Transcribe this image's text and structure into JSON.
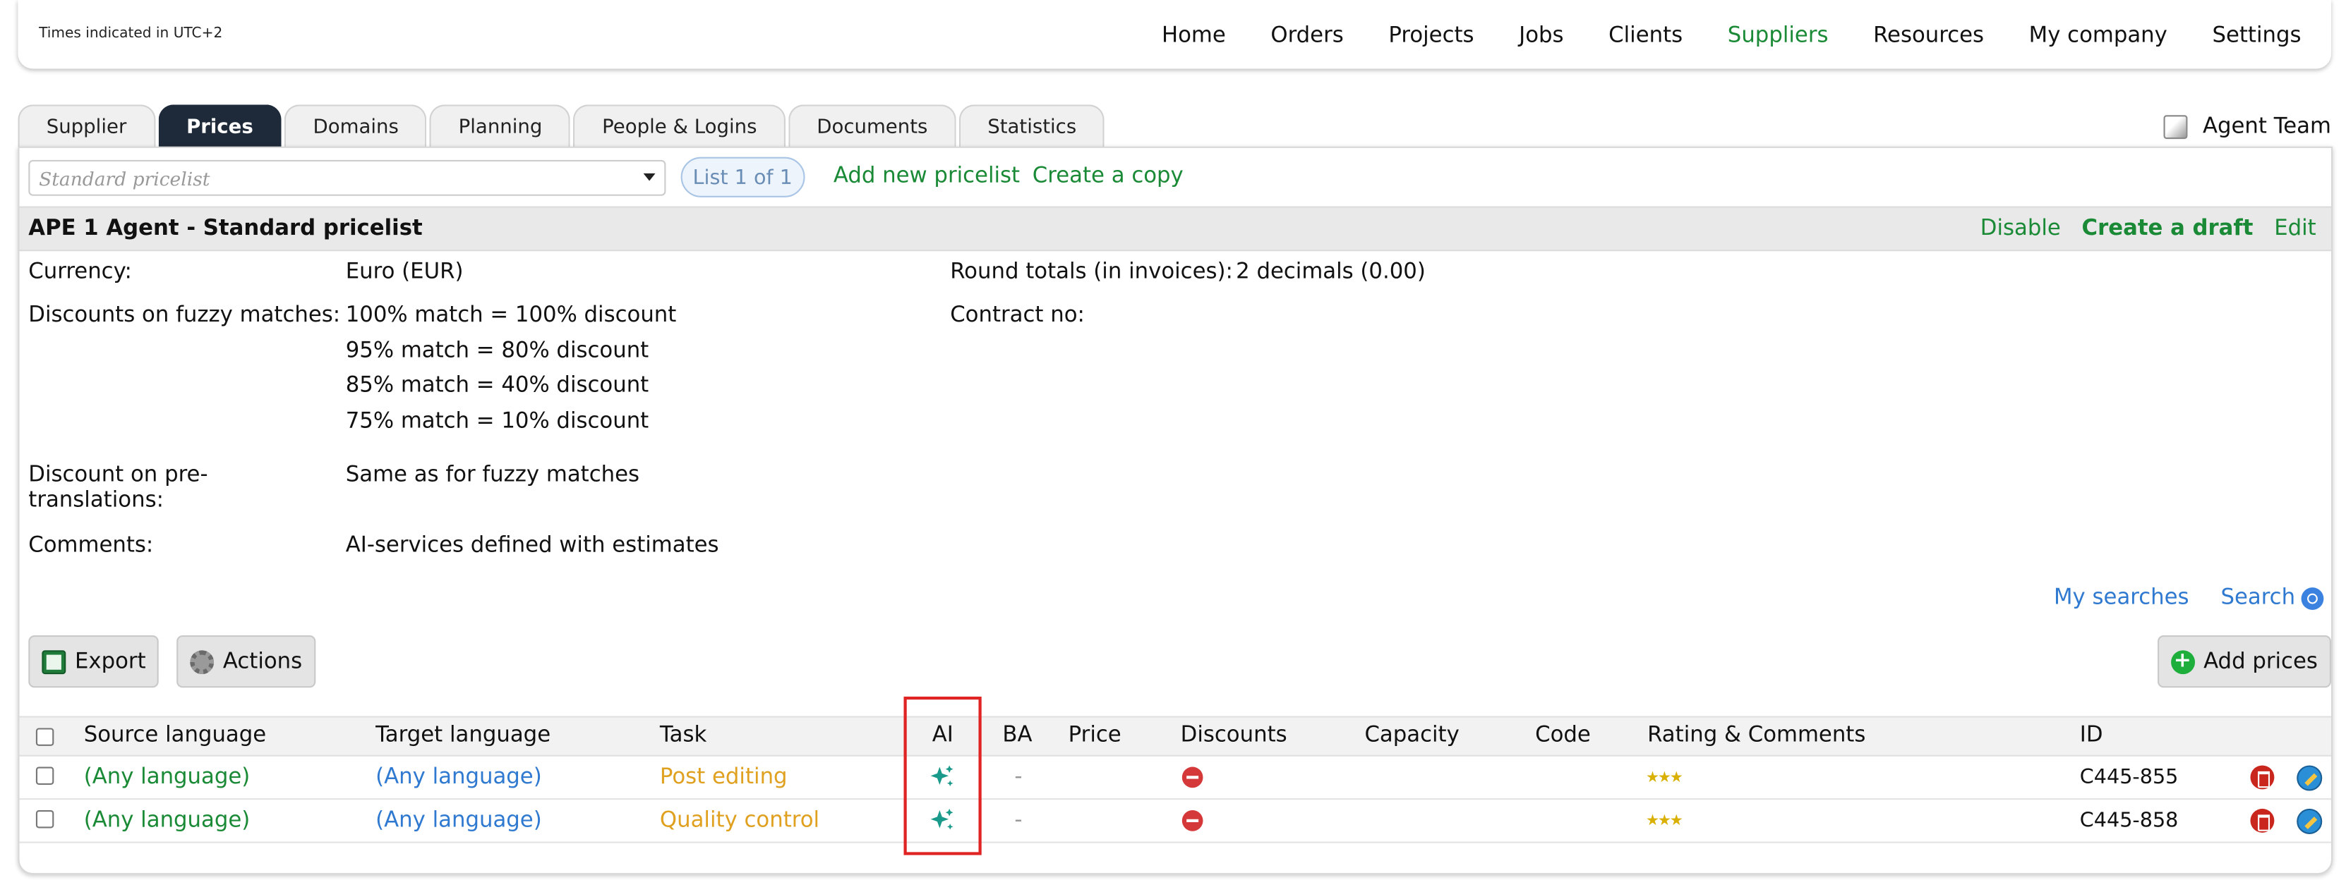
{
  "topbar": {
    "timezone_note": "Times indicated in UTC+2",
    "nav": [
      {
        "label": "Home",
        "active": false
      },
      {
        "label": "Orders",
        "active": false
      },
      {
        "label": "Projects",
        "active": false
      },
      {
        "label": "Jobs",
        "active": false
      },
      {
        "label": "Clients",
        "active": false
      },
      {
        "label": "Suppliers",
        "active": true
      },
      {
        "label": "Resources",
        "active": false
      },
      {
        "label": "My company",
        "active": false
      },
      {
        "label": "Settings",
        "active": false
      }
    ]
  },
  "tabs": [
    {
      "label": "Supplier",
      "active": false
    },
    {
      "label": "Prices",
      "active": true
    },
    {
      "label": "Domains",
      "active": false
    },
    {
      "label": "Planning",
      "active": false
    },
    {
      "label": "People & Logins",
      "active": false
    },
    {
      "label": "Documents",
      "active": false
    },
    {
      "label": "Statistics",
      "active": false
    }
  ],
  "supplier_name": "Agent Team",
  "pricelist_bar": {
    "select_placeholder": "Standard pricelist",
    "list_counter": "List 1 of 1",
    "add_new": "Add new pricelist",
    "create_copy": "Create a copy"
  },
  "pricelist_header": {
    "title": "APE 1 Agent - Standard pricelist",
    "disable": "Disable",
    "create_draft": "Create a draft",
    "edit": "Edit"
  },
  "details": {
    "currency_label": "Currency:",
    "currency_value": "Euro (EUR)",
    "round_label": "Round totals (in invoices):",
    "round_value": "2 decimals (0.00)",
    "fuzzy_label": "Discounts on fuzzy matches:",
    "fuzzy_values": [
      "100% match = 100% discount",
      "95% match = 80% discount",
      "85% match = 40% discount",
      "75% match = 10% discount"
    ],
    "contract_label": "Contract no:",
    "contract_value": "",
    "pretrans_label_1": "Discount on pre-",
    "pretrans_label_2": "translations:",
    "pretrans_value": "Same as for fuzzy matches",
    "comments_label": "Comments:",
    "comments_value": "AI-services defined with estimates"
  },
  "search": {
    "my_searches": "My searches",
    "search": "Search"
  },
  "toolbar": {
    "export": "Export",
    "actions": "Actions",
    "add_prices": "Add prices"
  },
  "table": {
    "columns": [
      "Source language",
      "Target language",
      "Task",
      "AI",
      "BA",
      "Price",
      "Discounts",
      "Capacity",
      "Code",
      "Rating & Comments",
      "ID"
    ],
    "rows": [
      {
        "source": "(Any language)",
        "target": "(Any language)",
        "task": "Post editing",
        "ai_icon": "sparkle-icon",
        "ba": "-",
        "price": "",
        "discounts_icon": "no-entry-icon",
        "capacity": "",
        "code": "",
        "rating": "★★★",
        "id": "C445-855"
      },
      {
        "source": "(Any language)",
        "target": "(Any language)",
        "task": "Quality control",
        "ai_icon": "sparkle-icon",
        "ba": "-",
        "price": "",
        "discounts_icon": "no-entry-icon",
        "capacity": "",
        "code": "",
        "rating": "★★★",
        "id": "C445-858"
      }
    ]
  },
  "colors": {
    "active_green": "#1a8a36",
    "link_blue": "#2f7ad0",
    "task_orange": "#e0a020",
    "tab_active_bg": "#1e2a3a",
    "highlight_red": "#e02424"
  }
}
